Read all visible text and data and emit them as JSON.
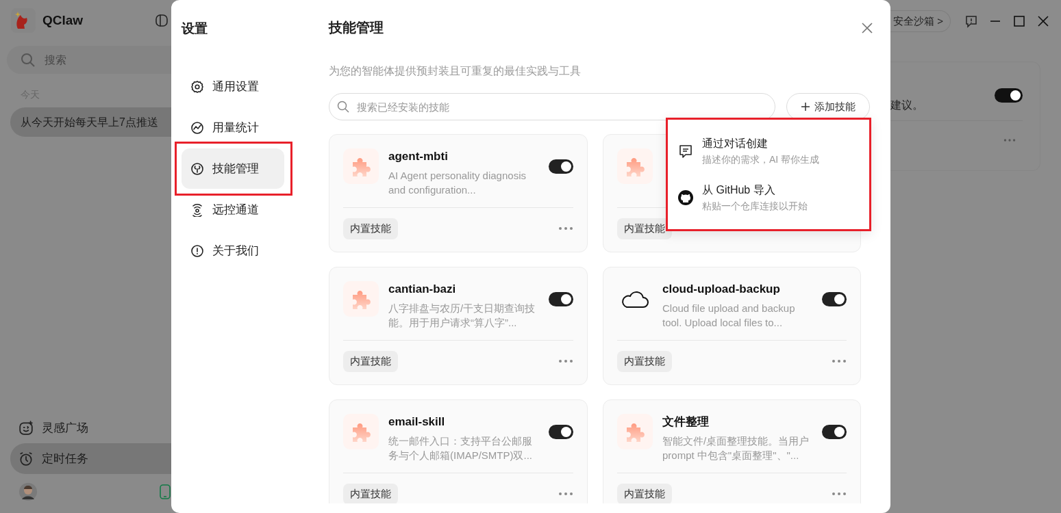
{
  "app": {
    "name": "QClaw",
    "search": {
      "placeholder": "搜索"
    },
    "history_heading": "今天",
    "history": [
      {
        "title": "从今天开始每天早上7点推送",
        "selected": true
      }
    ],
    "bottom_nav": [
      {
        "label": "灵感广场",
        "selected": false
      },
      {
        "label": "定时任务",
        "selected": true
      }
    ],
    "header": {
      "sandbox": "安全沙箱 >"
    },
    "background_card": {
      "description": "建议。",
      "on": true
    }
  },
  "settings": {
    "title": "设置",
    "nav": [
      {
        "label": "通用设置",
        "selected": false,
        "highlighted": false
      },
      {
        "label": "用量统计",
        "selected": false,
        "highlighted": false
      },
      {
        "label": "技能管理",
        "selected": true,
        "highlighted": true
      },
      {
        "label": "远控通道",
        "selected": false,
        "highlighted": false
      },
      {
        "label": "关于我们",
        "selected": false,
        "highlighted": false
      }
    ],
    "page": {
      "title": "技能管理",
      "subtitle": "为您的智能体提供预封装且可重复的最佳实践与工具",
      "search": {
        "placeholder": "搜索已经安装的技能"
      },
      "add_button": "添加技能",
      "menu": {
        "highlighted": true,
        "items": [
          {
            "title": "通过对话创建",
            "hint": "描述你的需求，AI 帮你生成"
          },
          {
            "title": "从 GitHub 导入",
            "hint": "粘贴一个仓库连接以开始"
          }
        ]
      },
      "skills": [
        {
          "kind": "puzzle",
          "name": "agent-mbti",
          "description": "AI Agent personality diagnosis and configuration...",
          "on": true,
          "tag": "内置技能"
        },
        {
          "kind": "puzzle",
          "tag": "内置技能"
        },
        {
          "kind": "puzzle",
          "name": "cantian-bazi",
          "description": "八字排盘与农历/干支日期查询技能。用于用户请求“算八字”...",
          "on": true,
          "tag": "内置技能"
        },
        {
          "kind": "cloud",
          "name": "cloud-upload-backup",
          "description": "Cloud file upload and backup tool. Upload local files to...",
          "on": true,
          "tag": "内置技能"
        },
        {
          "kind": "puzzle",
          "name": "email-skill",
          "description": "统一邮件入口：支持平台公邮服务与个人邮箱(IMAP/SMTP)双...",
          "on": true,
          "tag": "内置技能"
        },
        {
          "kind": "puzzle",
          "name": "文件整理",
          "description": "智能文件/桌面整理技能。当用户prompt 中包含\"桌面整理\"、\"...",
          "on": true,
          "tag": "内置技能"
        }
      ]
    }
  }
}
